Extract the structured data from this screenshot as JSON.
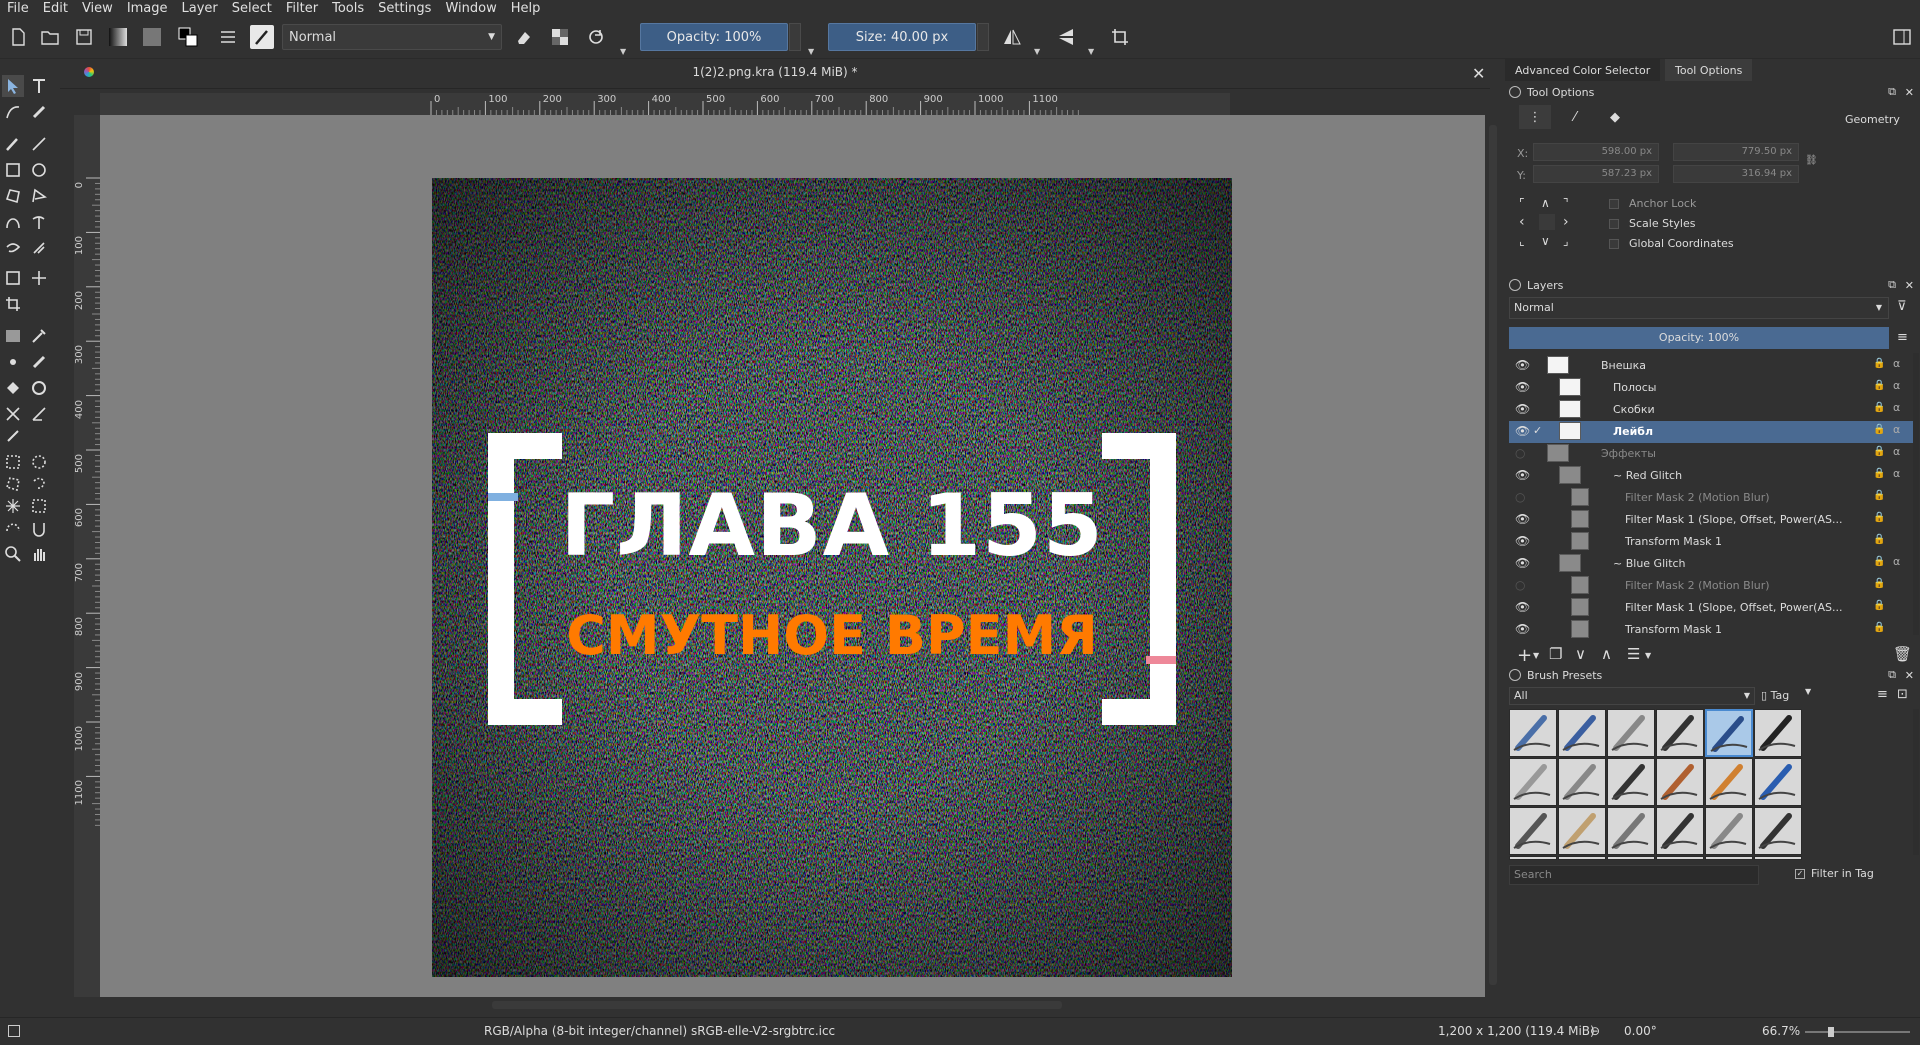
{
  "menubar": {
    "items": [
      "File",
      "Edit",
      "View",
      "Image",
      "Layer",
      "Select",
      "Filter",
      "Tools",
      "Settings",
      "Window",
      "Help"
    ]
  },
  "toolbar": {
    "blend_mode": "Normal",
    "opacity_label": "Opacity: 100%",
    "size_label": "Size: 40.00 px",
    "icons": [
      "new-document-icon",
      "open-document-icon",
      "save-icon",
      "gradient-icon",
      "pattern-icon",
      "color-swap-icon",
      "brush-editor-icon",
      "brush-preset-icon",
      "eraser-icon",
      "alpha-lock-icon",
      "reload-icon",
      "mirror-horizontal-icon",
      "mirror-vertical-icon",
      "wrap-around-icon",
      "toggle-dockers-icon"
    ]
  },
  "document": {
    "tab_title": "1(2)2.png.kra (119.4 MiB) *",
    "ruler_top_ticks": [
      "0",
      "100",
      "200",
      "300",
      "400",
      "500",
      "600",
      "700",
      "800",
      "900",
      "1000",
      "1100"
    ],
    "ruler_left_ticks": [
      "0",
      "100",
      "200",
      "300",
      "400",
      "500",
      "600",
      "700",
      "800",
      "900",
      "1000",
      "1100"
    ],
    "image_title": "ГЛАВА 155",
    "image_subtitle": "СМУТНОЕ ВРЕМЯ",
    "title_color": "#ffffff",
    "subtitle_color": "#ff7a00"
  },
  "status": {
    "color_profile": "RGB/Alpha (8-bit integer/channel)  sRGB-elle-V2-srgbtrc.icc",
    "dimensions": "1,200 x 1,200 (119.4 MiB)",
    "rotation": "0.00°",
    "zoom": "66.7%"
  },
  "dock": {
    "tabs": [
      "Advanced Color Selector",
      "Tool Options"
    ],
    "tool_options": {
      "title": "Tool Options",
      "geometry_label": "Geometry",
      "x_label": "X:",
      "y_label": "Y:",
      "x_value": "598.00 px",
      "w_value": "779.50 px",
      "y_value": "587.23 px",
      "h_value": "316.94 px",
      "anchor_lock": "Anchor Lock",
      "scale_styles": "Scale Styles",
      "global_coords": "Global Coordinates"
    },
    "layers": {
      "title": "Layers",
      "blend_mode": "Normal",
      "opacity": "Opacity:  100%",
      "rows": [
        {
          "name": "Внешка",
          "visible": true
        },
        {
          "name": "Полосы",
          "visible": true
        },
        {
          "name": "Скобки",
          "visible": true
        },
        {
          "name": "Лейбл",
          "visible": true,
          "selected": true
        },
        {
          "name": "Эффекты",
          "visible": false
        },
        {
          "name": "~ Red Glitch",
          "visible": true
        },
        {
          "name": "Filter Mask 2 (Motion Blur)",
          "visible": false
        },
        {
          "name": "Filter Mask 1 (Slope, Offset, Power(AS...",
          "visible": true
        },
        {
          "name": "Transform Mask 1",
          "visible": true
        },
        {
          "name": "~ Blue Glitch",
          "visible": true
        },
        {
          "name": "Filter Mask 2 (Motion Blur)",
          "visible": false
        },
        {
          "name": "Filter Mask 1 (Slope, Offset, Power(AS...",
          "visible": true
        },
        {
          "name": "Transform Mask 1",
          "visible": true
        }
      ]
    },
    "brush_presets": {
      "title": "Brush Presets",
      "filter_value": "All",
      "tag_label": "Tag",
      "search_placeholder": "Search",
      "filter_in_tag": "Filter in Tag"
    }
  }
}
